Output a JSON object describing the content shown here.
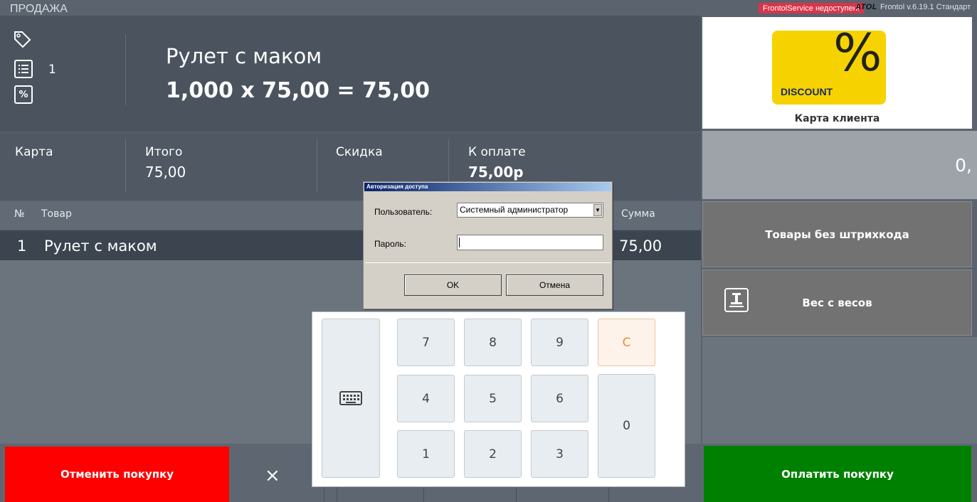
{
  "window": {
    "mode": "ПРОДАЖА",
    "service_status": "FrontolService недоступен!",
    "brand_logo": "ATOL",
    "version": "Frontol v.6.19.1 Стандарт"
  },
  "product": {
    "count": "1",
    "name": "Рулет с маком",
    "calculation": "1,000 x 75,00 = 75,00",
    "icons": [
      "tag-icon",
      "list-icon",
      "percent-icon"
    ]
  },
  "totals": {
    "card_label": "Карта",
    "total_label": "Итого",
    "total_value": "75,00",
    "discount_label": "Скидка",
    "to_pay_label": "К оплате",
    "to_pay_value": "75,00р"
  },
  "table": {
    "headers": [
      "№",
      "Товар",
      "Сумма"
    ],
    "rows": [
      {
        "num": "1",
        "name": "Рулет с маком",
        "sum": "75,00"
      }
    ]
  },
  "right_panel": {
    "discount_badge_symbol": "%",
    "discount_badge_text": "DISCOUNT",
    "customer_card_label": "Карта клиента",
    "quantity_value": "0,",
    "no_barcode_button": "Товары без штрихкода",
    "scale_button": "Вес с весов"
  },
  "bottom": {
    "cancel_button": "Отменить покупку",
    "pay_button": "Оплатить покупку",
    "close_symbol": "×"
  },
  "numpad": {
    "keys": [
      "7",
      "8",
      "9",
      "C",
      "4",
      "5",
      "6",
      "1",
      "2",
      "3",
      "0"
    ],
    "keyboard_icon": "keyboard-icon"
  },
  "dialog": {
    "title": "Авторизация доступа",
    "user_label": "Пользователь:",
    "user_value": "Системный администратор",
    "password_label": "Пароль:",
    "password_value": "",
    "ok_button": "OK",
    "cancel_button": "Отмена"
  },
  "colors": {
    "cancel": "#ff0000",
    "pay": "#008000",
    "service_alert": "#d9344a",
    "discount_badge": "#f6d300"
  }
}
